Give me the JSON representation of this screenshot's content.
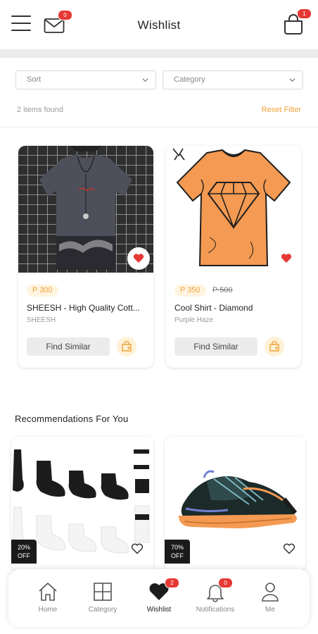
{
  "header": {
    "title": "Wishlist",
    "mail_badge": "0",
    "cart_badge": "1"
  },
  "filters": {
    "sort_label": "Sort",
    "category_label": "Category",
    "count_text": "2 items found",
    "reset_label": "Reset Filter"
  },
  "wishlist": {
    "items": [
      {
        "price": "P 300",
        "old_price": "",
        "name": "SHEESH - High Quality Cott...",
        "brand": "SHEESH",
        "find_label": "Find Similar",
        "image": "dark-tshirt-photo"
      },
      {
        "price": "P 350",
        "old_price": "P 500",
        "name": "Cool Shirt - Diamond",
        "brand": "Purple Haze",
        "find_label": "Find Similar",
        "image": "orange-diamond-tshirt"
      }
    ]
  },
  "recommendations": {
    "title": "Recommendations For You",
    "items": [
      {
        "discount_pct": "20%",
        "discount_suffix": "OFF",
        "image": "socks-set"
      },
      {
        "discount_pct": "70%",
        "discount_suffix": "OFF",
        "image": "trail-sneaker"
      }
    ]
  },
  "nav": {
    "items": [
      {
        "label": "Home",
        "icon": "home-icon"
      },
      {
        "label": "Category",
        "icon": "grid-icon"
      },
      {
        "label": "Wishlist",
        "icon": "heart-icon",
        "badge": "2"
      },
      {
        "label": "Notifications",
        "icon": "bell-icon",
        "badge": "0"
      },
      {
        "label": "Me",
        "icon": "user-icon"
      }
    ]
  },
  "colors": {
    "accent": "#f0a23a",
    "badge": "#e53935",
    "heart": "#e53935"
  }
}
